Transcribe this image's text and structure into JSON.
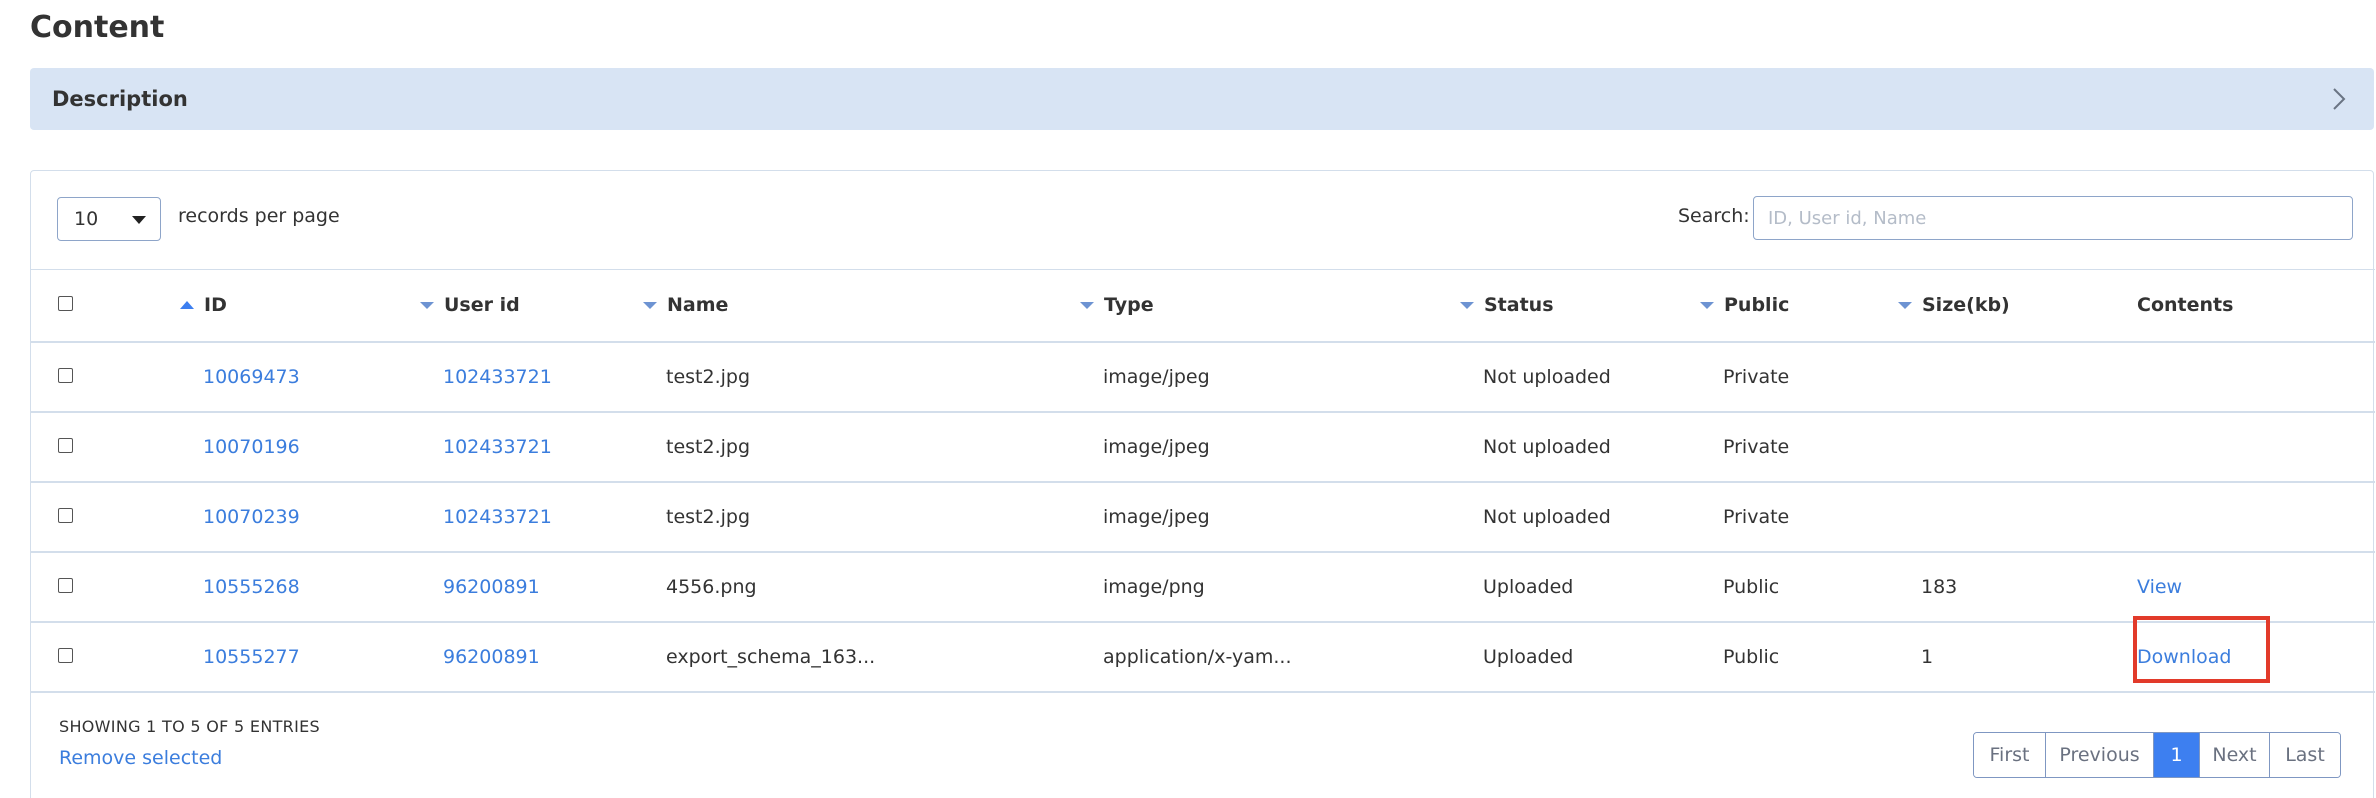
{
  "page": {
    "title": "Content"
  },
  "description": {
    "label": "Description"
  },
  "toolbar": {
    "page_size": "10",
    "per_page_label": "records per page",
    "search_label": "Search:",
    "search_placeholder": "ID, User id, Name",
    "search_value": ""
  },
  "table": {
    "headers": {
      "id": "ID",
      "user_id": "User id",
      "name": "Name",
      "type": "Type",
      "status": "Status",
      "public": "Public",
      "size": "Size(kb)",
      "contents": "Contents"
    },
    "sort": {
      "column": "id",
      "direction": "asc"
    },
    "rows": [
      {
        "id": "10069473",
        "user_id": "102433721",
        "name": "test2.jpg",
        "type": "image/jpeg",
        "status": "Not uploaded",
        "public": "Private",
        "size": "",
        "contents": "",
        "checked": false
      },
      {
        "id": "10070196",
        "user_id": "102433721",
        "name": "test2.jpg",
        "type": "image/jpeg",
        "status": "Not uploaded",
        "public": "Private",
        "size": "",
        "contents": "",
        "checked": false
      },
      {
        "id": "10070239",
        "user_id": "102433721",
        "name": "test2.jpg",
        "type": "image/jpeg",
        "status": "Not uploaded",
        "public": "Private",
        "size": "",
        "contents": "",
        "checked": false
      },
      {
        "id": "10555268",
        "user_id": "96200891",
        "name": "4556.png",
        "type": "image/png",
        "status": "Uploaded",
        "public": "Public",
        "size": "183",
        "contents": "View",
        "checked": false
      },
      {
        "id": "10555277",
        "user_id": "96200891",
        "name": "export_schema_163...",
        "type": "application/x-yam...",
        "status": "Uploaded",
        "public": "Public",
        "size": "1",
        "contents": "Download",
        "checked": false
      }
    ]
  },
  "footer": {
    "info": "SHOWING 1 TO 5 OF 5 ENTRIES",
    "remove_selected": "Remove selected"
  },
  "pagination": {
    "first": "First",
    "previous": "Previous",
    "current": "1",
    "next": "Next",
    "last": "Last"
  },
  "colors": {
    "accent": "#3d7ff0",
    "link": "#3b7ddd",
    "description_bar": "#d8e4f4",
    "highlight": "#e23a2a"
  }
}
